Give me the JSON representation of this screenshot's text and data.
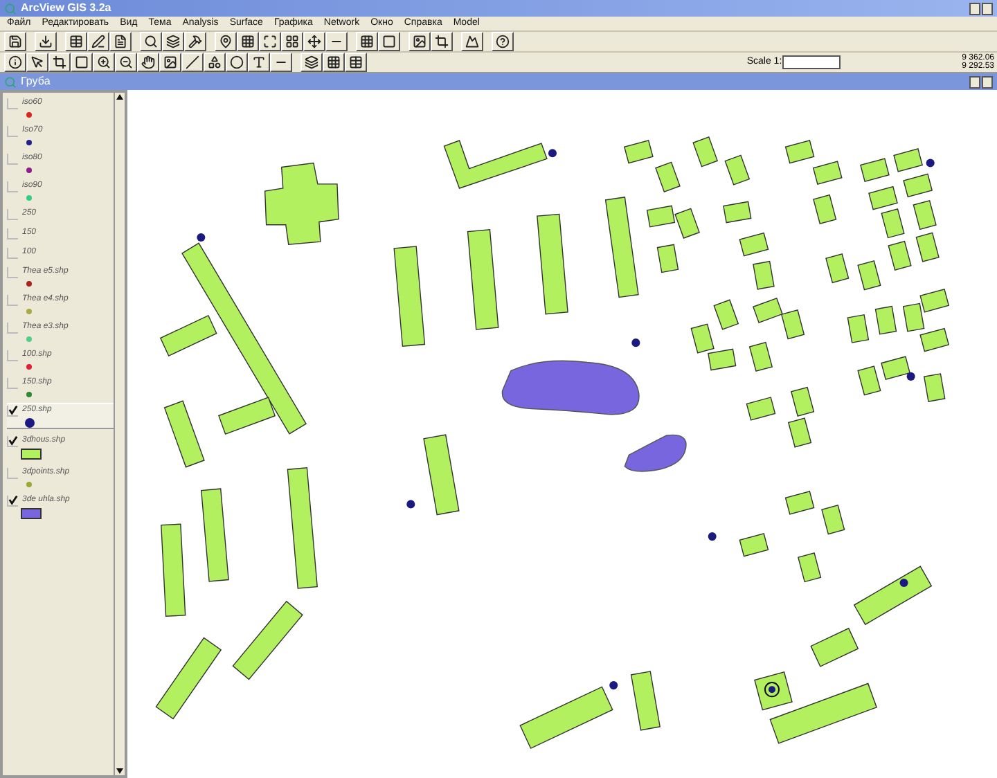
{
  "window": {
    "title": "ArcView GIS 3.2a"
  },
  "menu": [
    "Файл",
    "Редактировать",
    "Вид",
    "Тема",
    "Analysis",
    "Surface",
    "Графика",
    "Network",
    "Окно",
    "Справка",
    "Model"
  ],
  "scale": {
    "label": "Scale 1:"
  },
  "coordinates": [
    "9 362.06",
    "9 292.53"
  ],
  "view": {
    "title": "Грубa"
  },
  "legend": [
    {
      "label": "iso60",
      "checked": false,
      "selected": false,
      "kind": "point",
      "color": "#dd2222"
    },
    {
      "label": "Iso70",
      "checked": false,
      "selected": false,
      "kind": "point",
      "color": "#222288"
    },
    {
      "label": "iso80",
      "checked": false,
      "selected": false,
      "kind": "point",
      "color": "#882288"
    },
    {
      "label": "iso90",
      "checked": false,
      "selected": false,
      "kind": "point",
      "color": "#33cc88"
    },
    {
      "label": "250",
      "checked": false,
      "selected": false,
      "kind": "text"
    },
    {
      "label": "150",
      "checked": false,
      "selected": false,
      "kind": "text"
    },
    {
      "label": "100",
      "checked": false,
      "selected": false,
      "kind": "text"
    },
    {
      "label": "Thea e5.shp",
      "checked": false,
      "selected": false,
      "kind": "point",
      "color": "#aa2222"
    },
    {
      "label": "Thea e4.shp",
      "checked": false,
      "selected": false,
      "kind": "point",
      "color": "#aaaa44"
    },
    {
      "label": "Thea e3.shp",
      "checked": false,
      "selected": false,
      "kind": "point",
      "color": "#55cc88"
    },
    {
      "label": "100.shp",
      "checked": false,
      "selected": false,
      "kind": "point",
      "color": "#dd2233"
    },
    {
      "label": "150.shp",
      "checked": false,
      "selected": false,
      "kind": "point",
      "color": "#338833"
    },
    {
      "label": "250.shp",
      "checked": true,
      "selected": true,
      "kind": "large_point",
      "color": "#1a1a80"
    },
    {
      "label": "3dhous.shp",
      "checked": true,
      "selected": false,
      "kind": "fill",
      "color": "#b2f060"
    },
    {
      "label": "3dpoints.shp",
      "checked": false,
      "selected": false,
      "kind": "point",
      "color": "#99aa33"
    },
    {
      "label": "3de uhla.shp",
      "checked": true,
      "selected": false,
      "kind": "fill",
      "color": "#7766dd"
    }
  ]
}
